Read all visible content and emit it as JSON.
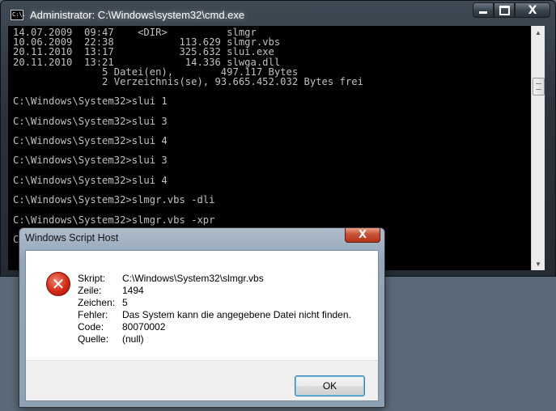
{
  "cmd_window": {
    "title": "Administrator: C:\\Windows\\system32\\cmd.exe",
    "icon": "cmd-icon",
    "icon_text": "C:\\.",
    "close_glyph": "X",
    "lines": [
      "14.07.2009  09:47    <DIR>          slmgr",
      "10.06.2009  22:38           113.629 slmgr.vbs",
      "20.11.2010  13:17           325.632 slui.exe",
      "20.11.2010  13:21            14.336 slwga.dll",
      "               5 Datei(en),        497.117 Bytes",
      "               2 Verzeichnis(se), 93.665.452.032 Bytes frei",
      "",
      "C:\\Windows\\System32>slui 1",
      "",
      "C:\\Windows\\System32>slui 3",
      "",
      "C:\\Windows\\System32>slui 4",
      "",
      "C:\\Windows\\System32>slui 3",
      "",
      "C:\\Windows\\System32>slui 4",
      "",
      "C:\\Windows\\System32>slmgr.vbs -dli",
      "",
      "C:\\Windows\\System32>slmgr.vbs -xpr",
      "",
      "C"
    ]
  },
  "dialog": {
    "title": "Windows Script Host",
    "close_glyph": "X",
    "icon": "error-icon",
    "icon_glyph": "✕",
    "rows": [
      {
        "label": "Skript:",
        "value": "C:\\Windows\\System32\\slmgr.vbs"
      },
      {
        "label": "Zeile:",
        "value": "1494"
      },
      {
        "label": "Zeichen:",
        "value": "5"
      },
      {
        "label": "Fehler:",
        "value": "Das System kann die angegebene Datei nicht finden."
      },
      {
        "label": "Code:",
        "value": "80070002"
      },
      {
        "label": "Quelle:",
        "value": "(null)"
      }
    ],
    "ok_label": "OK"
  }
}
